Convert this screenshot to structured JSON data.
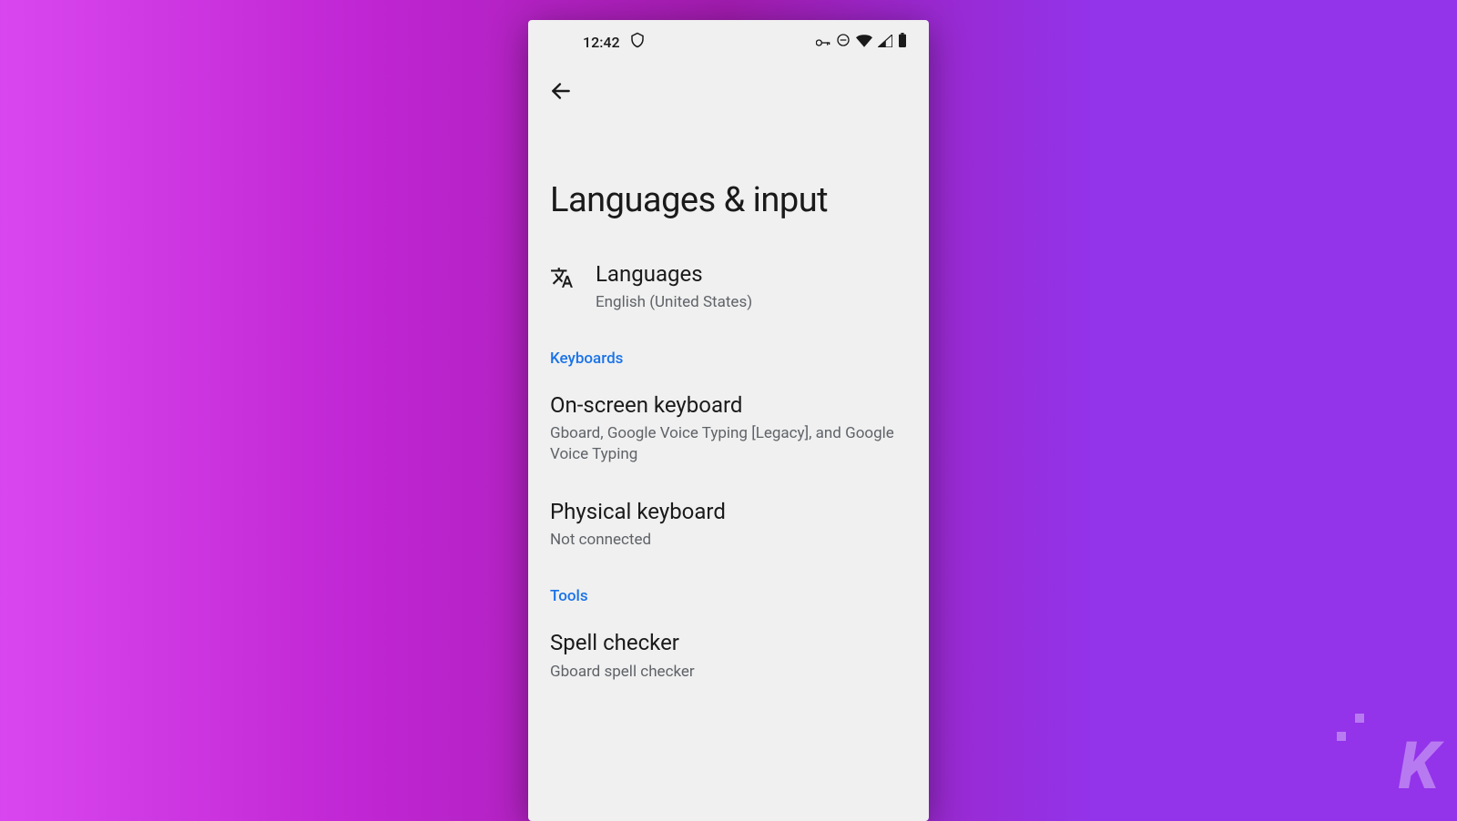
{
  "status_bar": {
    "time": "12:42",
    "icons": {
      "shield": "shield-icon",
      "key": "key-icon",
      "dnd": "do-not-disturb-icon",
      "wifi": "wifi-icon",
      "signal": "cell-signal-icon",
      "battery": "battery-icon"
    }
  },
  "page": {
    "title": "Languages & input"
  },
  "items": {
    "languages": {
      "title": "Languages",
      "subtitle": "English (United States)"
    }
  },
  "sections": {
    "keyboards": {
      "header": "Keyboards",
      "on_screen": {
        "title": "On-screen keyboard",
        "subtitle": "Gboard, Google Voice Typing [Legacy], and Google Voice Typing"
      },
      "physical": {
        "title": "Physical keyboard",
        "subtitle": "Not connected"
      }
    },
    "tools": {
      "header": "Tools",
      "spell_checker": {
        "title": "Spell checker",
        "subtitle": "Gboard spell checker"
      }
    }
  },
  "watermark": {
    "text": "K"
  },
  "colors": {
    "accent": "#1a73e8",
    "text_primary": "#1a1a1a",
    "text_secondary": "#5f6368",
    "phone_bg": "#f0f0f0"
  }
}
